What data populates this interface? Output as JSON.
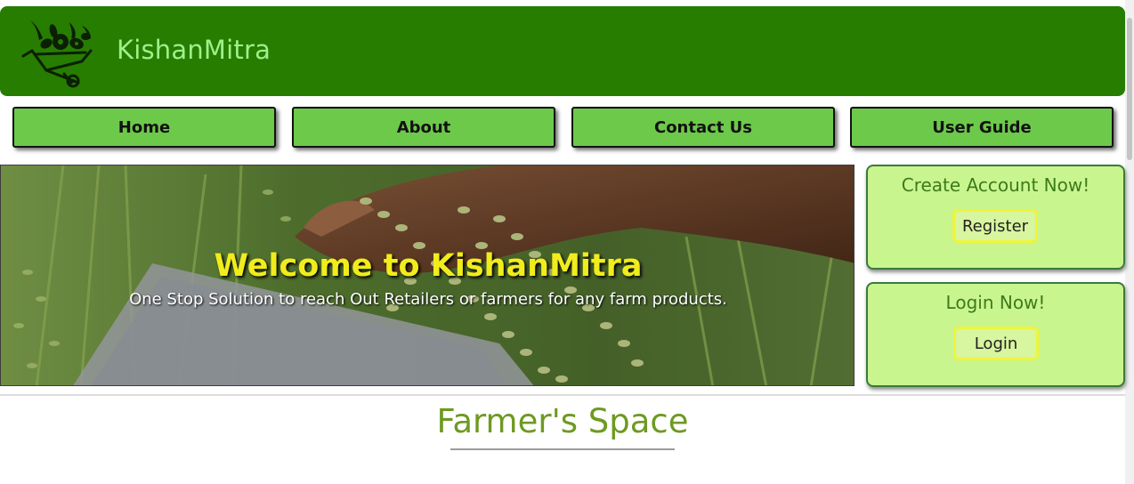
{
  "header": {
    "brand": "KishanMitra",
    "logo_icon": "farm-cart-logo-icon",
    "bg_color": "#267d00",
    "brand_color": "#9ff08a"
  },
  "nav": {
    "items": [
      {
        "label": "Home"
      },
      {
        "label": "About"
      },
      {
        "label": "Contact Us"
      },
      {
        "label": "User Guide"
      }
    ],
    "button_color": "#6dc94a"
  },
  "hero": {
    "title": "Welcome to KishanMitra",
    "subtitle": "One Stop Solution to reach Out Retailers or farmers for any farm products.",
    "title_color": "#f1ec1c"
  },
  "register_card": {
    "title": "Create Account Now!",
    "button_label": "Register"
  },
  "login_card": {
    "title": "Login Now!",
    "button_label": "Login"
  },
  "section": {
    "title": "Farmer's Space",
    "title_color": "#6e9a22"
  }
}
